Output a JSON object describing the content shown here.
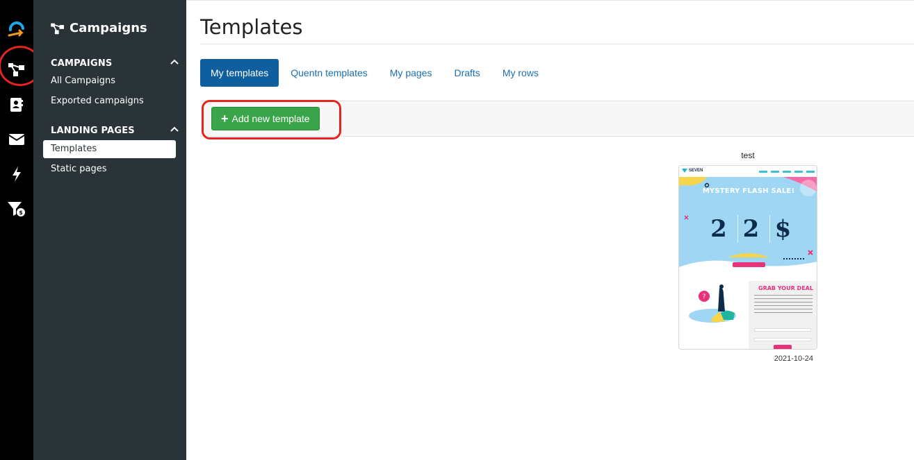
{
  "app": {
    "rail_icons": [
      "logo-icon",
      "campaigns-icon",
      "contacts-icon",
      "email-icon",
      "automation-icon",
      "funnel-revenue-icon"
    ],
    "accent_color": "#0f5f9f",
    "annotation_color": "#e5231f"
  },
  "sidebar": {
    "title": "Campaigns",
    "sections": [
      {
        "label": "CAMPAIGNS",
        "items": [
          "All Campaigns",
          "Exported campaigns"
        ]
      },
      {
        "label": "LANDING PAGES",
        "items": [
          "Templates",
          "Static pages"
        ]
      }
    ],
    "active_item": "Templates"
  },
  "main": {
    "title": "Templates",
    "tabs": [
      "My templates",
      "Quentn templates",
      "My pages",
      "Drafts",
      "My rows"
    ],
    "active_tab": "My templates",
    "add_button_label": "Add new template",
    "add_button_color": "#3aa44a"
  },
  "templates": [
    {
      "name": "test",
      "date": "2021-10-24",
      "thumbnail": {
        "logo": "SEVEN",
        "headline": "MYSTERY FLASH SALE!",
        "digits": [
          "2",
          "2",
          "$"
        ],
        "form_title": "GRAB YOUR DEAL"
      }
    }
  ]
}
